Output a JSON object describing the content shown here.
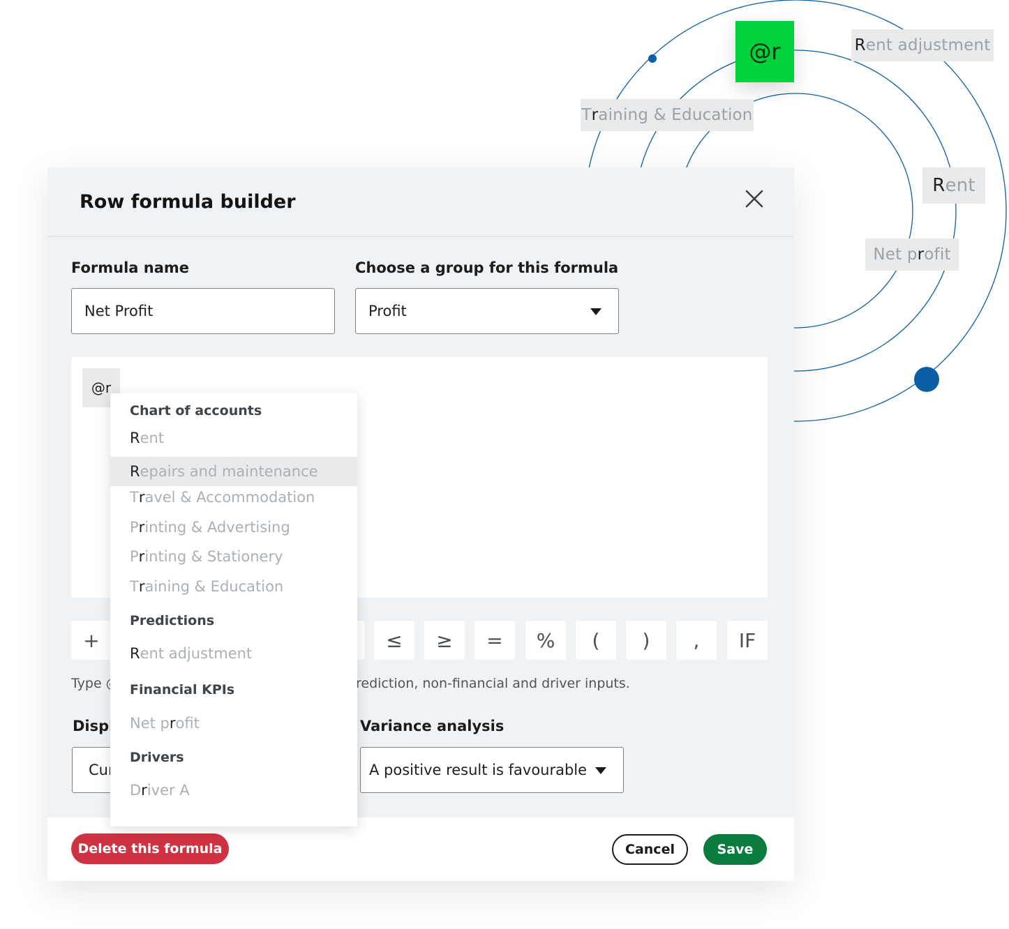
{
  "decor": {
    "at_chip": "@r",
    "chips": [
      {
        "match": "R",
        "rest": "ent adjustment"
      },
      {
        "pre": "T",
        "match": "r",
        "rest": "aining & Education"
      },
      {
        "match": "R",
        "rest": "ent"
      },
      {
        "pre": "Net p",
        "match": "r",
        "rest": "ofit"
      }
    ]
  },
  "modal": {
    "title": "Row formula builder",
    "formula_name_label": "Formula name",
    "formula_name_value": "Net Profit",
    "group_label": "Choose a group for this formula",
    "group_value": "Profit",
    "formula_token": "@r",
    "operators": [
      "+",
      "≤",
      "≥",
      "=",
      "%",
      "(",
      ")",
      ",",
      "IF"
    ],
    "helper_left": "Type @",
    "helper_right": "rediction, non-financial and driver inputs.",
    "display_label": "Displ",
    "display_value": "Cur",
    "variance_label": "Variance analysis",
    "variance_value": "A positive result is favourable",
    "delete_label": "Delete this formula",
    "cancel_label": "Cancel",
    "save_label": "Save"
  },
  "dropdown": {
    "groups": [
      {
        "label": "Chart of accounts"
      },
      {
        "label": "Predictions"
      },
      {
        "label": "Financial KPIs"
      },
      {
        "label": "Drivers"
      }
    ],
    "items": [
      {
        "pre": "",
        "match": "R",
        "rest": "ent"
      },
      {
        "pre": "",
        "match": "R",
        "rest": "epairs and maintenance"
      },
      {
        "pre": "T",
        "match": "r",
        "rest": "avel & Accommodation"
      },
      {
        "pre": "P",
        "match": "r",
        "rest": "inting & Advertising"
      },
      {
        "pre": "P",
        "match": "r",
        "rest": "inting & Stationery"
      },
      {
        "pre": "T",
        "match": "r",
        "rest": "aining & Education"
      },
      {
        "pre": "",
        "match": "R",
        "rest": "ent adjustment"
      },
      {
        "pre": "Net p",
        "match": "r",
        "rest": "ofit"
      },
      {
        "pre": "D",
        "match": "r",
        "rest": "iver A"
      }
    ]
  },
  "colors": {
    "accent_green": "#00d23c",
    "save_green": "#0c7b3e",
    "delete_red": "#cf3342",
    "orbit_blue": "#0b5fa5"
  }
}
